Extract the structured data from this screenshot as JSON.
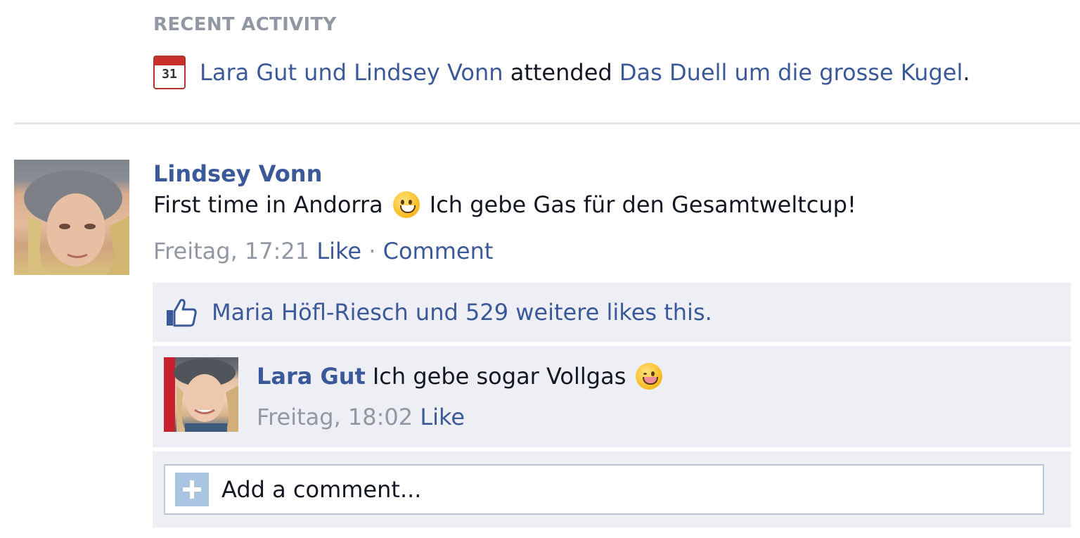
{
  "recent_activity": {
    "header": "RECENT ACTIVITY",
    "calendar_icon": "calendar-icon",
    "calendar_day": "31",
    "actors": "Lara Gut und Lindsey Vonn",
    "verb": "attended",
    "event": "Das Duell um die grosse Kugel",
    "period": "."
  },
  "post": {
    "author": "Lindsey Vonn",
    "text_before": "First time in Andorra",
    "text_after": "Ich gebe Gas für den Gesamtweltcup!",
    "timestamp": "Freitag, 17:21",
    "like_label": "Like",
    "separator": "·",
    "comment_label": "Comment"
  },
  "likes": {
    "icon": "thumbs-up-icon",
    "text": "Maria Höfl-Riesch und 529 weitere likes this."
  },
  "comment": {
    "author": "Lara Gut",
    "text": "Ich gebe sogar Vollgas",
    "timestamp": "Freitag, 18:02",
    "like_label": "Like"
  },
  "add_comment": {
    "placeholder": "Add a comment..."
  },
  "colors": {
    "link": "#3b5998",
    "meta": "#9197a3",
    "panel": "#edeff4",
    "border": "#bdc7d8"
  }
}
